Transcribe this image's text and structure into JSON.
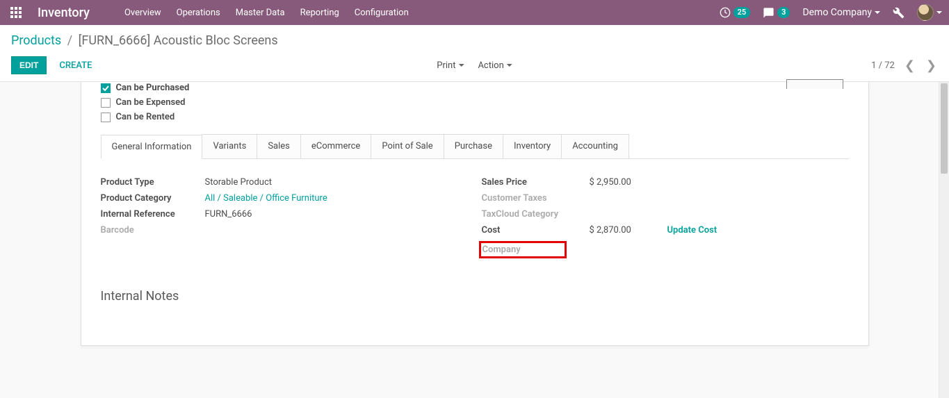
{
  "topbar": {
    "app_title": "Inventory",
    "nav": [
      "Overview",
      "Operations",
      "Master Data",
      "Reporting",
      "Configuration"
    ],
    "clock_badge": "25",
    "chat_badge": "3",
    "company": "Demo Company"
  },
  "breadcrumb": {
    "root": "Products",
    "sep": "/",
    "current": "[FURN_6666] Acoustic Bloc Screens"
  },
  "controls": {
    "edit": "EDIT",
    "create": "CREATE",
    "print": "Print",
    "action": "Action",
    "pager": "1 / 72"
  },
  "checks": {
    "can_be_purchased": "Can be Purchased",
    "can_be_expensed": "Can be Expensed",
    "can_be_rented": "Can be Rented"
  },
  "tabs": [
    "General Information",
    "Variants",
    "Sales",
    "eCommerce",
    "Point of Sale",
    "Purchase",
    "Inventory",
    "Accounting"
  ],
  "fields_left": {
    "product_type_label": "Product Type",
    "product_type_value": "Storable Product",
    "product_category_label": "Product Category",
    "product_category_value": "All / Saleable / Office Furniture",
    "internal_ref_label": "Internal Reference",
    "internal_ref_value": "FURN_6666",
    "barcode_label": "Barcode",
    "barcode_value": ""
  },
  "fields_right": {
    "sales_price_label": "Sales Price",
    "sales_price_value": "$ 2,950.00",
    "customer_taxes_label": "Customer Taxes",
    "taxcloud_label": "TaxCloud Category",
    "cost_label": "Cost",
    "cost_value": "$ 2,870.00",
    "update_cost": "Update Cost",
    "company_label": "Company"
  },
  "section": {
    "internal_notes": "Internal Notes"
  }
}
